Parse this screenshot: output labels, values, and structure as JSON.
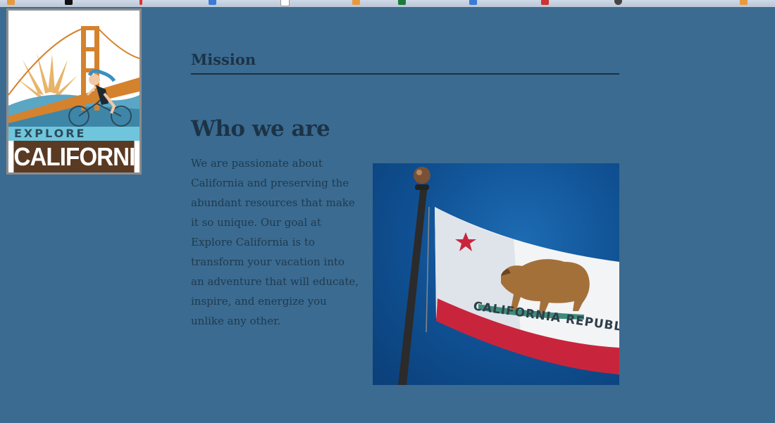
{
  "logo": {
    "line1": "EXPLORE",
    "line2": "CALIFORNIA"
  },
  "mission": {
    "heading": "Mission"
  },
  "about": {
    "heading": "Who we are",
    "paragraph": "We are passionate about California and preserving the abundant resources that make it so unique. Our goal at Explore California is to transform your vacation into an adventure that will educate, inspire, and energize you unlike any other."
  },
  "flag_image": {
    "banner_text": "CALIFORNIA REPUBLIC"
  },
  "colors": {
    "page_background": "#3b6b91",
    "heading": "#1c3346",
    "body_text": "#1f3a4e"
  }
}
